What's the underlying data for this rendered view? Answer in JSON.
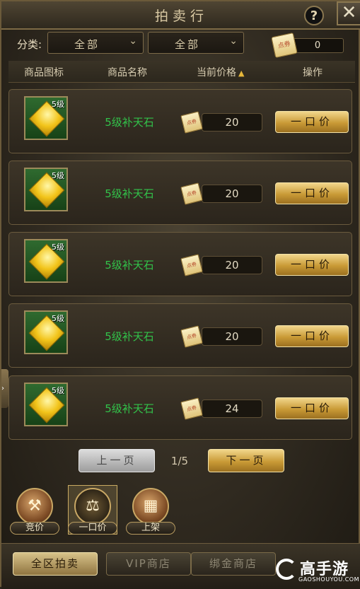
{
  "window": {
    "title": "拍卖行",
    "help_icon": "?",
    "close_icon": "✕"
  },
  "filter": {
    "label": "分类:",
    "select1": "全部",
    "select2": "全部",
    "coin_label": "点券",
    "balance": "0"
  },
  "table": {
    "headers": [
      "商品图标",
      "商品名称",
      "当前价格",
      "操作"
    ],
    "sort_indicator": "▲",
    "rows": [
      {
        "level": "5级",
        "name": "5级补天石",
        "price": "20",
        "coin": "点券",
        "action": "一口价"
      },
      {
        "level": "5级",
        "name": "5级补天石",
        "price": "20",
        "coin": "点券",
        "action": "一口价"
      },
      {
        "level": "5级",
        "name": "5级补天石",
        "price": "20",
        "coin": "点券",
        "action": "一口价"
      },
      {
        "level": "5级",
        "name": "5级补天石",
        "price": "20",
        "coin": "点券",
        "action": "一口价"
      },
      {
        "level": "5级",
        "name": "5级补天石",
        "price": "24",
        "coin": "点券",
        "action": "一口价"
      }
    ]
  },
  "pagination": {
    "prev": "上一页",
    "page": "1/5",
    "next": "下一页"
  },
  "modes": [
    {
      "label": "竞价",
      "icon": "gavel-icon",
      "glyph": "⚒"
    },
    {
      "label": "一口价",
      "icon": "scale-icon",
      "glyph": "⚖"
    },
    {
      "label": "上架",
      "icon": "shelf-icon",
      "glyph": "▦"
    }
  ],
  "tabs": [
    "全区拍卖",
    "VIP商店",
    "绑金商店"
  ],
  "logo": {
    "text": "高手游",
    "sub": "GAOSHOUYOU.COM"
  },
  "colors": {
    "item_name": "#32c24a",
    "gold_button": "#c99a36",
    "accent_sort": "#e6b73a"
  }
}
